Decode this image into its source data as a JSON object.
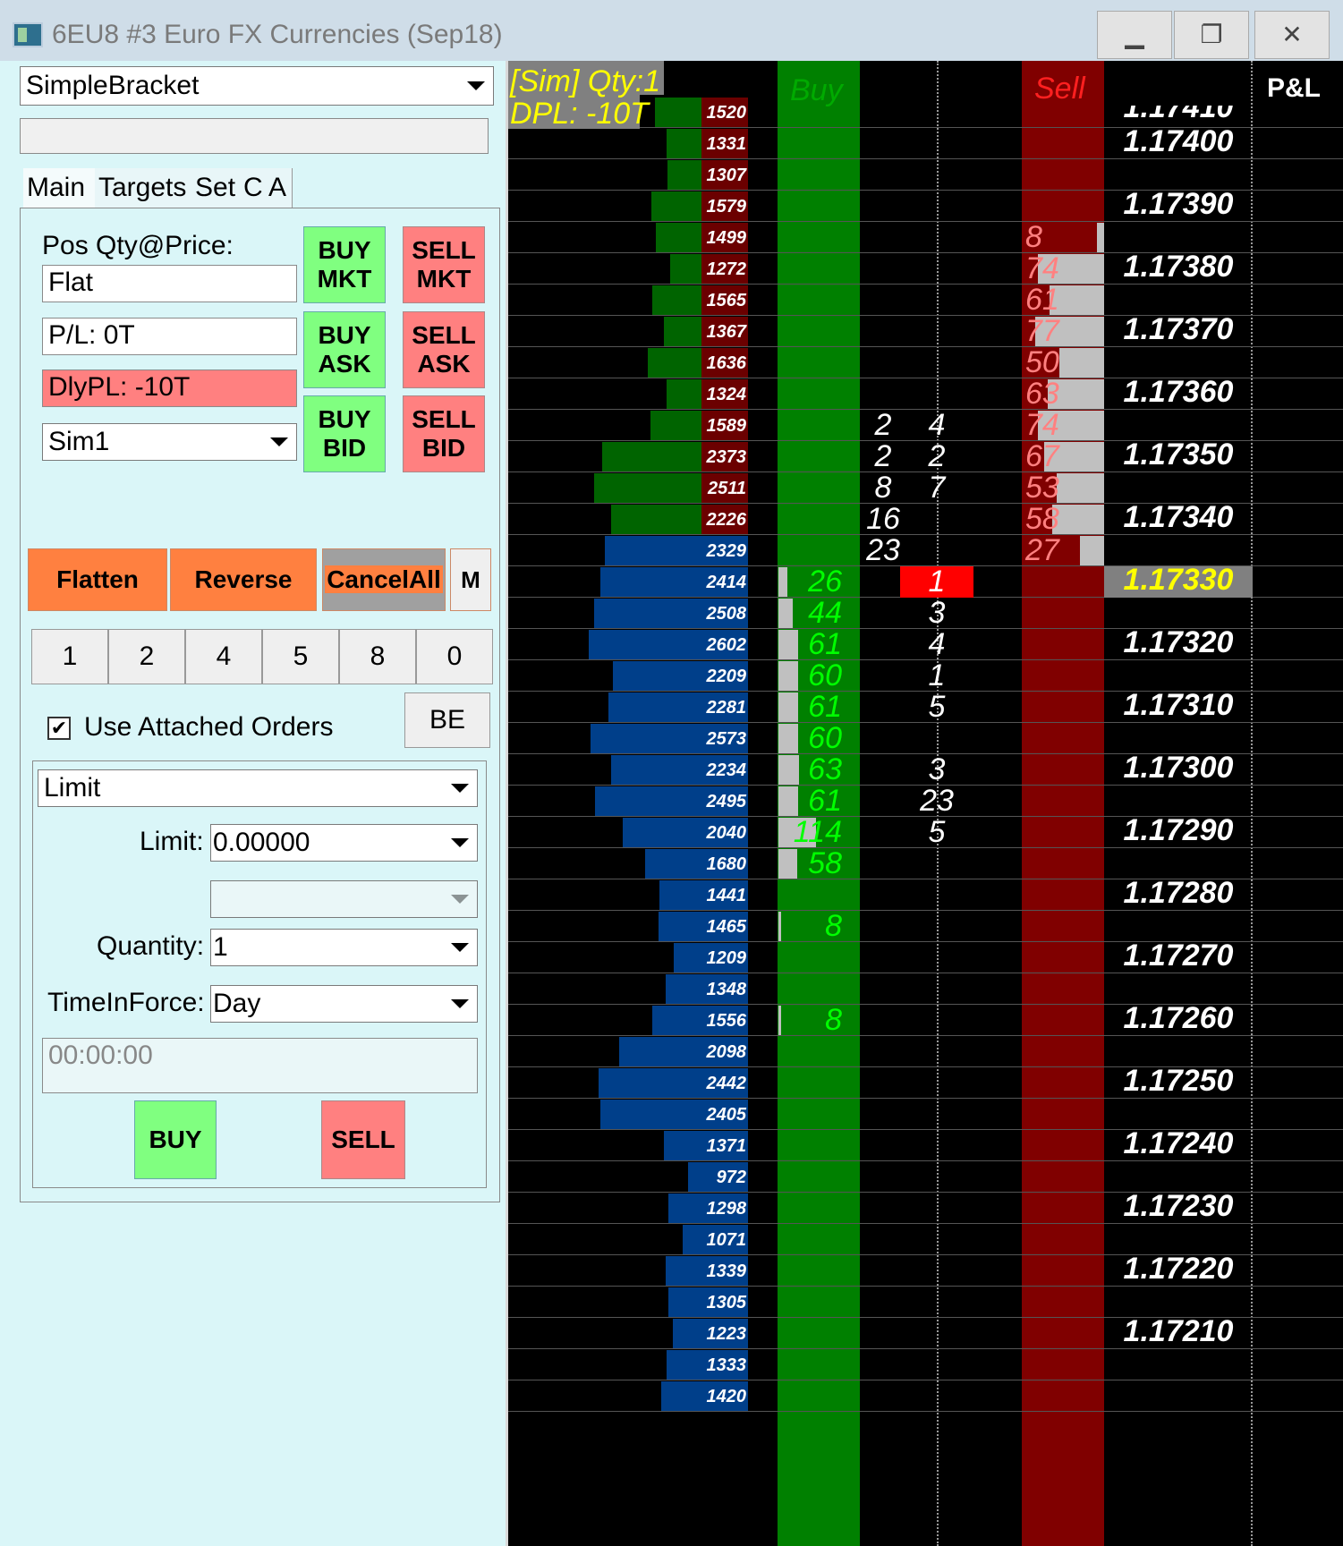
{
  "window": {
    "title": "6EU8  #3  Euro FX Currencies (Sep18)",
    "minimize_glyph": "▁",
    "restore_glyph": "❐",
    "close_glyph": "✕"
  },
  "atm": {
    "strategy": "SimpleBracket",
    "tabs": [
      "Main",
      "Targets",
      "Set",
      "C",
      "A"
    ],
    "pos_label": "Pos Qty@Price:",
    "pos_value": "Flat",
    "pl": "P/L: 0T",
    "daily_pl": "DlyPL: -10T",
    "account": "Sim1",
    "buy_mkt": "BUY\nMKT",
    "sell_mkt": "SELL\nMKT",
    "buy_ask": "BUY\nASK",
    "sell_ask": "SELL\nASK",
    "buy_bid": "BUY\nBID",
    "sell_bid": "SELL\nBID",
    "flatten": "Flatten",
    "reverse": "Reverse",
    "cancel_all": "CancelAll",
    "m": "M",
    "qty_buttons": [
      "1",
      "2",
      "4",
      "5",
      "8",
      "0"
    ],
    "use_attached": "Use Attached Orders",
    "be": "BE",
    "order_type": "Limit",
    "limit_label": "Limit:",
    "limit_value": "0.00000",
    "quantity_label": "Quantity:",
    "quantity_value": "1",
    "tif_label": "TimeInForce:",
    "tif_value": "Day",
    "time_value": "00:00:00",
    "buy": "BUY",
    "sell": "SELL",
    "colors": {
      "green": "#80ff80",
      "red": "#ff8080",
      "orange": "#ff8040"
    }
  },
  "dom": {
    "sim_label": "[Sim]  Qty:1",
    "dpl_label": "DPL: -10T",
    "buy_header": "Buy",
    "sell_header": "Sell",
    "pl_header": "P&L",
    "top_partial_price": "1.17410",
    "rows": [
      {
        "vol": "1520",
        "price": "",
        "bid": "",
        "ask": "",
        "c1": "",
        "c2": "",
        "side": "ask"
      },
      {
        "vol": "1331",
        "price": "1.17400",
        "bid": "",
        "ask": "",
        "c1": "",
        "c2": "",
        "side": "ask"
      },
      {
        "vol": "1307",
        "price": "",
        "bid": "",
        "ask": "",
        "c1": "",
        "c2": "",
        "side": "ask"
      },
      {
        "vol": "1579",
        "price": "1.17390",
        "bid": "",
        "ask": "",
        "c1": "",
        "c2": "",
        "side": "ask"
      },
      {
        "vol": "1499",
        "price": "",
        "bid": "",
        "ask": "8",
        "c1": "",
        "c2": "",
        "side": "ask"
      },
      {
        "vol": "1272",
        "price": "1.17380",
        "bid": "",
        "ask": "74",
        "c1": "",
        "c2": "",
        "side": "ask"
      },
      {
        "vol": "1565",
        "price": "",
        "bid": "",
        "ask": "61",
        "c1": "",
        "c2": "",
        "side": "ask"
      },
      {
        "vol": "1367",
        "price": "1.17370",
        "bid": "",
        "ask": "77",
        "c1": "",
        "c2": "",
        "side": "ask"
      },
      {
        "vol": "1636",
        "price": "",
        "bid": "",
        "ask": "50",
        "c1": "",
        "c2": "",
        "side": "ask"
      },
      {
        "vol": "1324",
        "price": "1.17360",
        "bid": "",
        "ask": "63",
        "c1": "",
        "c2": "",
        "side": "ask"
      },
      {
        "vol": "1589",
        "price": "",
        "bid": "",
        "ask": "74",
        "c1": "2",
        "c2": "4",
        "side": "ask"
      },
      {
        "vol": "2373",
        "price": "1.17350",
        "bid": "",
        "ask": "67",
        "c1": "2",
        "c2": "2",
        "side": "ask"
      },
      {
        "vol": "2511",
        "price": "",
        "bid": "",
        "ask": "53",
        "c1": "8",
        "c2": "7",
        "side": "ask"
      },
      {
        "vol": "2226",
        "price": "1.17340",
        "bid": "",
        "ask": "58",
        "c1": "16",
        "c2": "",
        "side": "ask"
      },
      {
        "vol": "2329",
        "price": "",
        "bid": "",
        "ask": "27",
        "c1": "23",
        "c2": "",
        "side": "bid"
      },
      {
        "vol": "2414",
        "price": "1.17330",
        "bid": "26",
        "ask": "",
        "c1": "",
        "c2": "1",
        "side": "bid"
      },
      {
        "vol": "2508",
        "price": "",
        "bid": "44",
        "ask": "",
        "c1": "",
        "c2": "3",
        "side": "bid"
      },
      {
        "vol": "2602",
        "price": "1.17320",
        "bid": "61",
        "ask": "",
        "c1": "",
        "c2": "4",
        "side": "bid"
      },
      {
        "vol": "2209",
        "price": "",
        "bid": "60",
        "ask": "",
        "c1": "",
        "c2": "1",
        "side": "bid"
      },
      {
        "vol": "2281",
        "price": "1.17310",
        "bid": "61",
        "ask": "",
        "c1": "",
        "c2": "5",
        "side": "bid"
      },
      {
        "vol": "2573",
        "price": "",
        "bid": "60",
        "ask": "",
        "c1": "",
        "c2": "",
        "side": "bid"
      },
      {
        "vol": "2234",
        "price": "1.17300",
        "bid": "63",
        "ask": "",
        "c1": "",
        "c2": "3",
        "side": "bid"
      },
      {
        "vol": "2495",
        "price": "",
        "bid": "61",
        "ask": "",
        "c1": "",
        "c2": "23",
        "side": "bid"
      },
      {
        "vol": "2040",
        "price": "1.17290",
        "bid": "114",
        "ask": "",
        "c1": "",
        "c2": "5",
        "side": "bid"
      },
      {
        "vol": "1680",
        "price": "",
        "bid": "58",
        "ask": "",
        "c1": "",
        "c2": "",
        "side": "bid"
      },
      {
        "vol": "1441",
        "price": "1.17280",
        "bid": "",
        "ask": "",
        "c1": "",
        "c2": "",
        "side": "bid"
      },
      {
        "vol": "1465",
        "price": "",
        "bid": "8",
        "ask": "",
        "c1": "",
        "c2": "",
        "side": "bid"
      },
      {
        "vol": "1209",
        "price": "1.17270",
        "bid": "",
        "ask": "",
        "c1": "",
        "c2": "",
        "side": "bid"
      },
      {
        "vol": "1348",
        "price": "",
        "bid": "",
        "ask": "",
        "c1": "",
        "c2": "",
        "side": "bid"
      },
      {
        "vol": "1556",
        "price": "1.17260",
        "bid": "8",
        "ask": "",
        "c1": "",
        "c2": "",
        "side": "bid"
      },
      {
        "vol": "2098",
        "price": "",
        "bid": "",
        "ask": "",
        "c1": "",
        "c2": "",
        "side": "bid"
      },
      {
        "vol": "2442",
        "price": "1.17250",
        "bid": "",
        "ask": "",
        "c1": "",
        "c2": "",
        "side": "bid"
      },
      {
        "vol": "2405",
        "price": "",
        "bid": "",
        "ask": "",
        "c1": "",
        "c2": "",
        "side": "bid"
      },
      {
        "vol": "1371",
        "price": "1.17240",
        "bid": "",
        "ask": "",
        "c1": "",
        "c2": "",
        "side": "bid"
      },
      {
        "vol": "972",
        "price": "",
        "bid": "",
        "ask": "",
        "c1": "",
        "c2": "",
        "side": "bid"
      },
      {
        "vol": "1298",
        "price": "1.17230",
        "bid": "",
        "ask": "",
        "c1": "",
        "c2": "",
        "side": "bid"
      },
      {
        "vol": "1071",
        "price": "",
        "bid": "",
        "ask": "",
        "c1": "",
        "c2": "",
        "side": "bid"
      },
      {
        "vol": "1339",
        "price": "1.17220",
        "bid": "",
        "ask": "",
        "c1": "",
        "c2": "",
        "side": "bid"
      },
      {
        "vol": "1305",
        "price": "",
        "bid": "",
        "ask": "",
        "c1": "",
        "c2": "",
        "side": "bid"
      },
      {
        "vol": "1223",
        "price": "1.17210",
        "bid": "",
        "ask": "",
        "c1": "",
        "c2": "",
        "side": "bid"
      },
      {
        "vol": "1333",
        "price": "",
        "bid": "",
        "ask": "",
        "c1": "",
        "c2": "",
        "side": "bid"
      },
      {
        "vol": "1420",
        "price": "",
        "bid": "",
        "ask": "",
        "c1": "",
        "c2": "",
        "side": "bid"
      }
    ],
    "last_price": "1.17330",
    "last_trade_qty": "1",
    "colors": {
      "bid_bar": "#003f8a",
      "ask_vol": "#6b0000",
      "vol_green": "#006400",
      "buy_col": "#008000",
      "sell_col": "#800000",
      "last_price": "#ffff00"
    }
  }
}
